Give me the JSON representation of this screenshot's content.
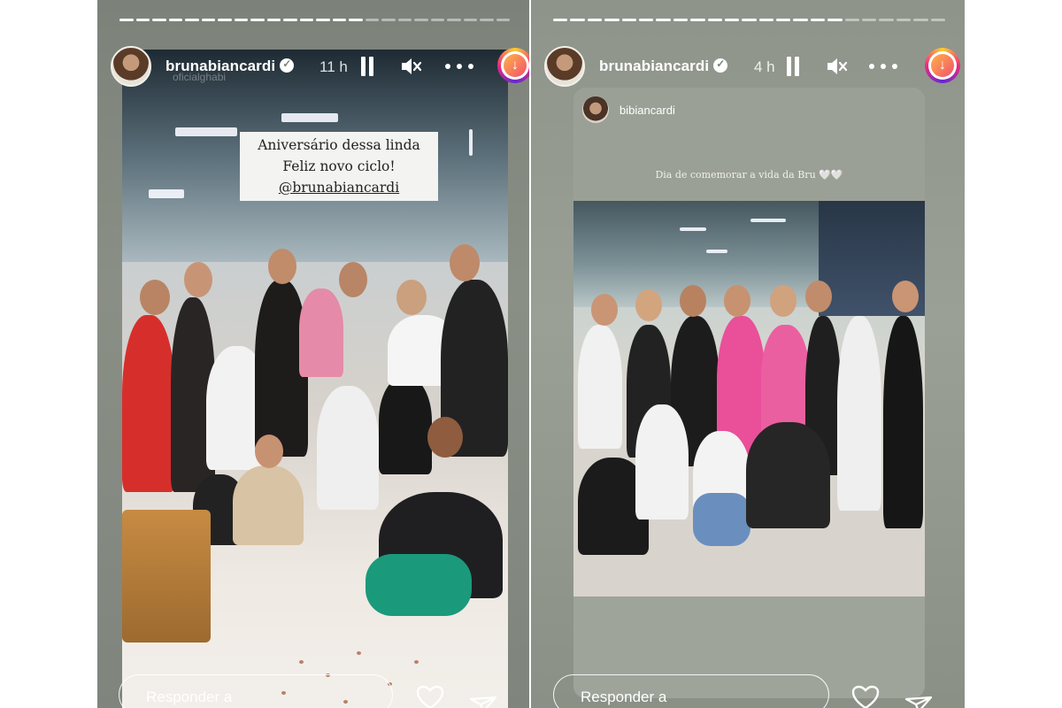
{
  "left_story": {
    "username": "brunabiancardi",
    "time": "11 h",
    "sub_username": "oficialghabi",
    "caption_line1": "Aniversário dessa linda",
    "caption_line2": "Feliz novo ciclo!",
    "caption_mention": "@brunabiancardi",
    "reply_placeholder": "Responder a",
    "progress_done_fraction": 0.62
  },
  "right_story": {
    "username": "brunabiancardi",
    "time": "4 h",
    "shared_username": "bibiancardi",
    "shared_caption": "Dia de comemorar a vida da Bru 🤍🤍",
    "reply_placeholder": "Responder a",
    "progress_done_fraction": 0.72
  },
  "icons": {
    "verified": "verified-badge-icon",
    "pause": "pause-icon",
    "mute": "speaker-muted-icon",
    "more": "more-dots-icon",
    "download": "download-icon",
    "like": "heart-icon",
    "share": "send-icon"
  },
  "colors": {
    "accent_gradient_start": "#f9ce34",
    "accent_gradient_mid": "#ee2a7b",
    "accent_gradient_end": "#6228d7"
  }
}
